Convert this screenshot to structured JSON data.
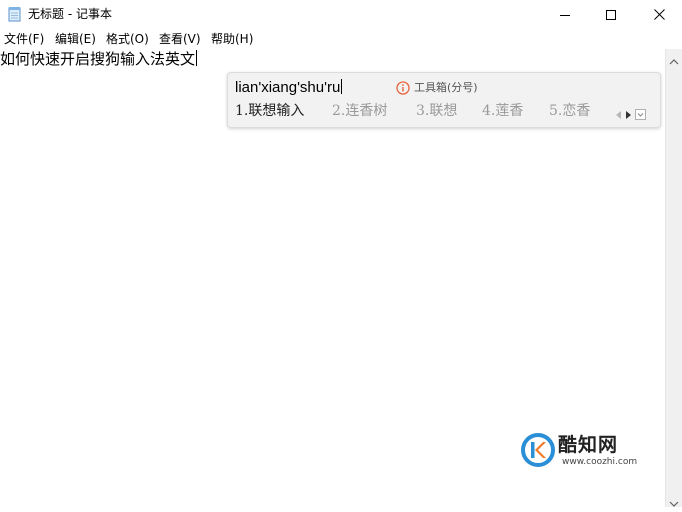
{
  "window": {
    "title": "无标题 - 记事本",
    "controls": [
      "minimize-icon",
      "maximize-icon",
      "close-icon"
    ]
  },
  "menu": {
    "items": [
      {
        "label": "文件(F)"
      },
      {
        "label": "编辑(E)"
      },
      {
        "label": "格式(O)"
      },
      {
        "label": "查看(V)"
      },
      {
        "label": "帮助(H)"
      }
    ]
  },
  "editor": {
    "text": "如何快速开启搜狗输入法英文"
  },
  "ime": {
    "pinyin": "lian'xiang'shu'ru",
    "toolbox_label": "工具箱(分号)",
    "candidates": [
      {
        "label": "1.联想输入"
      },
      {
        "label": "2.连香树"
      },
      {
        "label": "3.联想"
      },
      {
        "label": "4.莲香"
      },
      {
        "label": "5.恋香"
      }
    ],
    "icons": [
      "info-icon",
      "page-prev-icon",
      "page-next-icon",
      "expand-icon"
    ],
    "colors": {
      "panel": "#f2f2f2",
      "candidate_first": "#222222",
      "candidate_other": "#9a9a9a",
      "info": "#e8643c"
    }
  },
  "watermark": {
    "name": "酷知网",
    "url": "www.coozhi.com",
    "colors": {
      "ring": "#2a8fd6",
      "accent": "#f07a26"
    }
  }
}
